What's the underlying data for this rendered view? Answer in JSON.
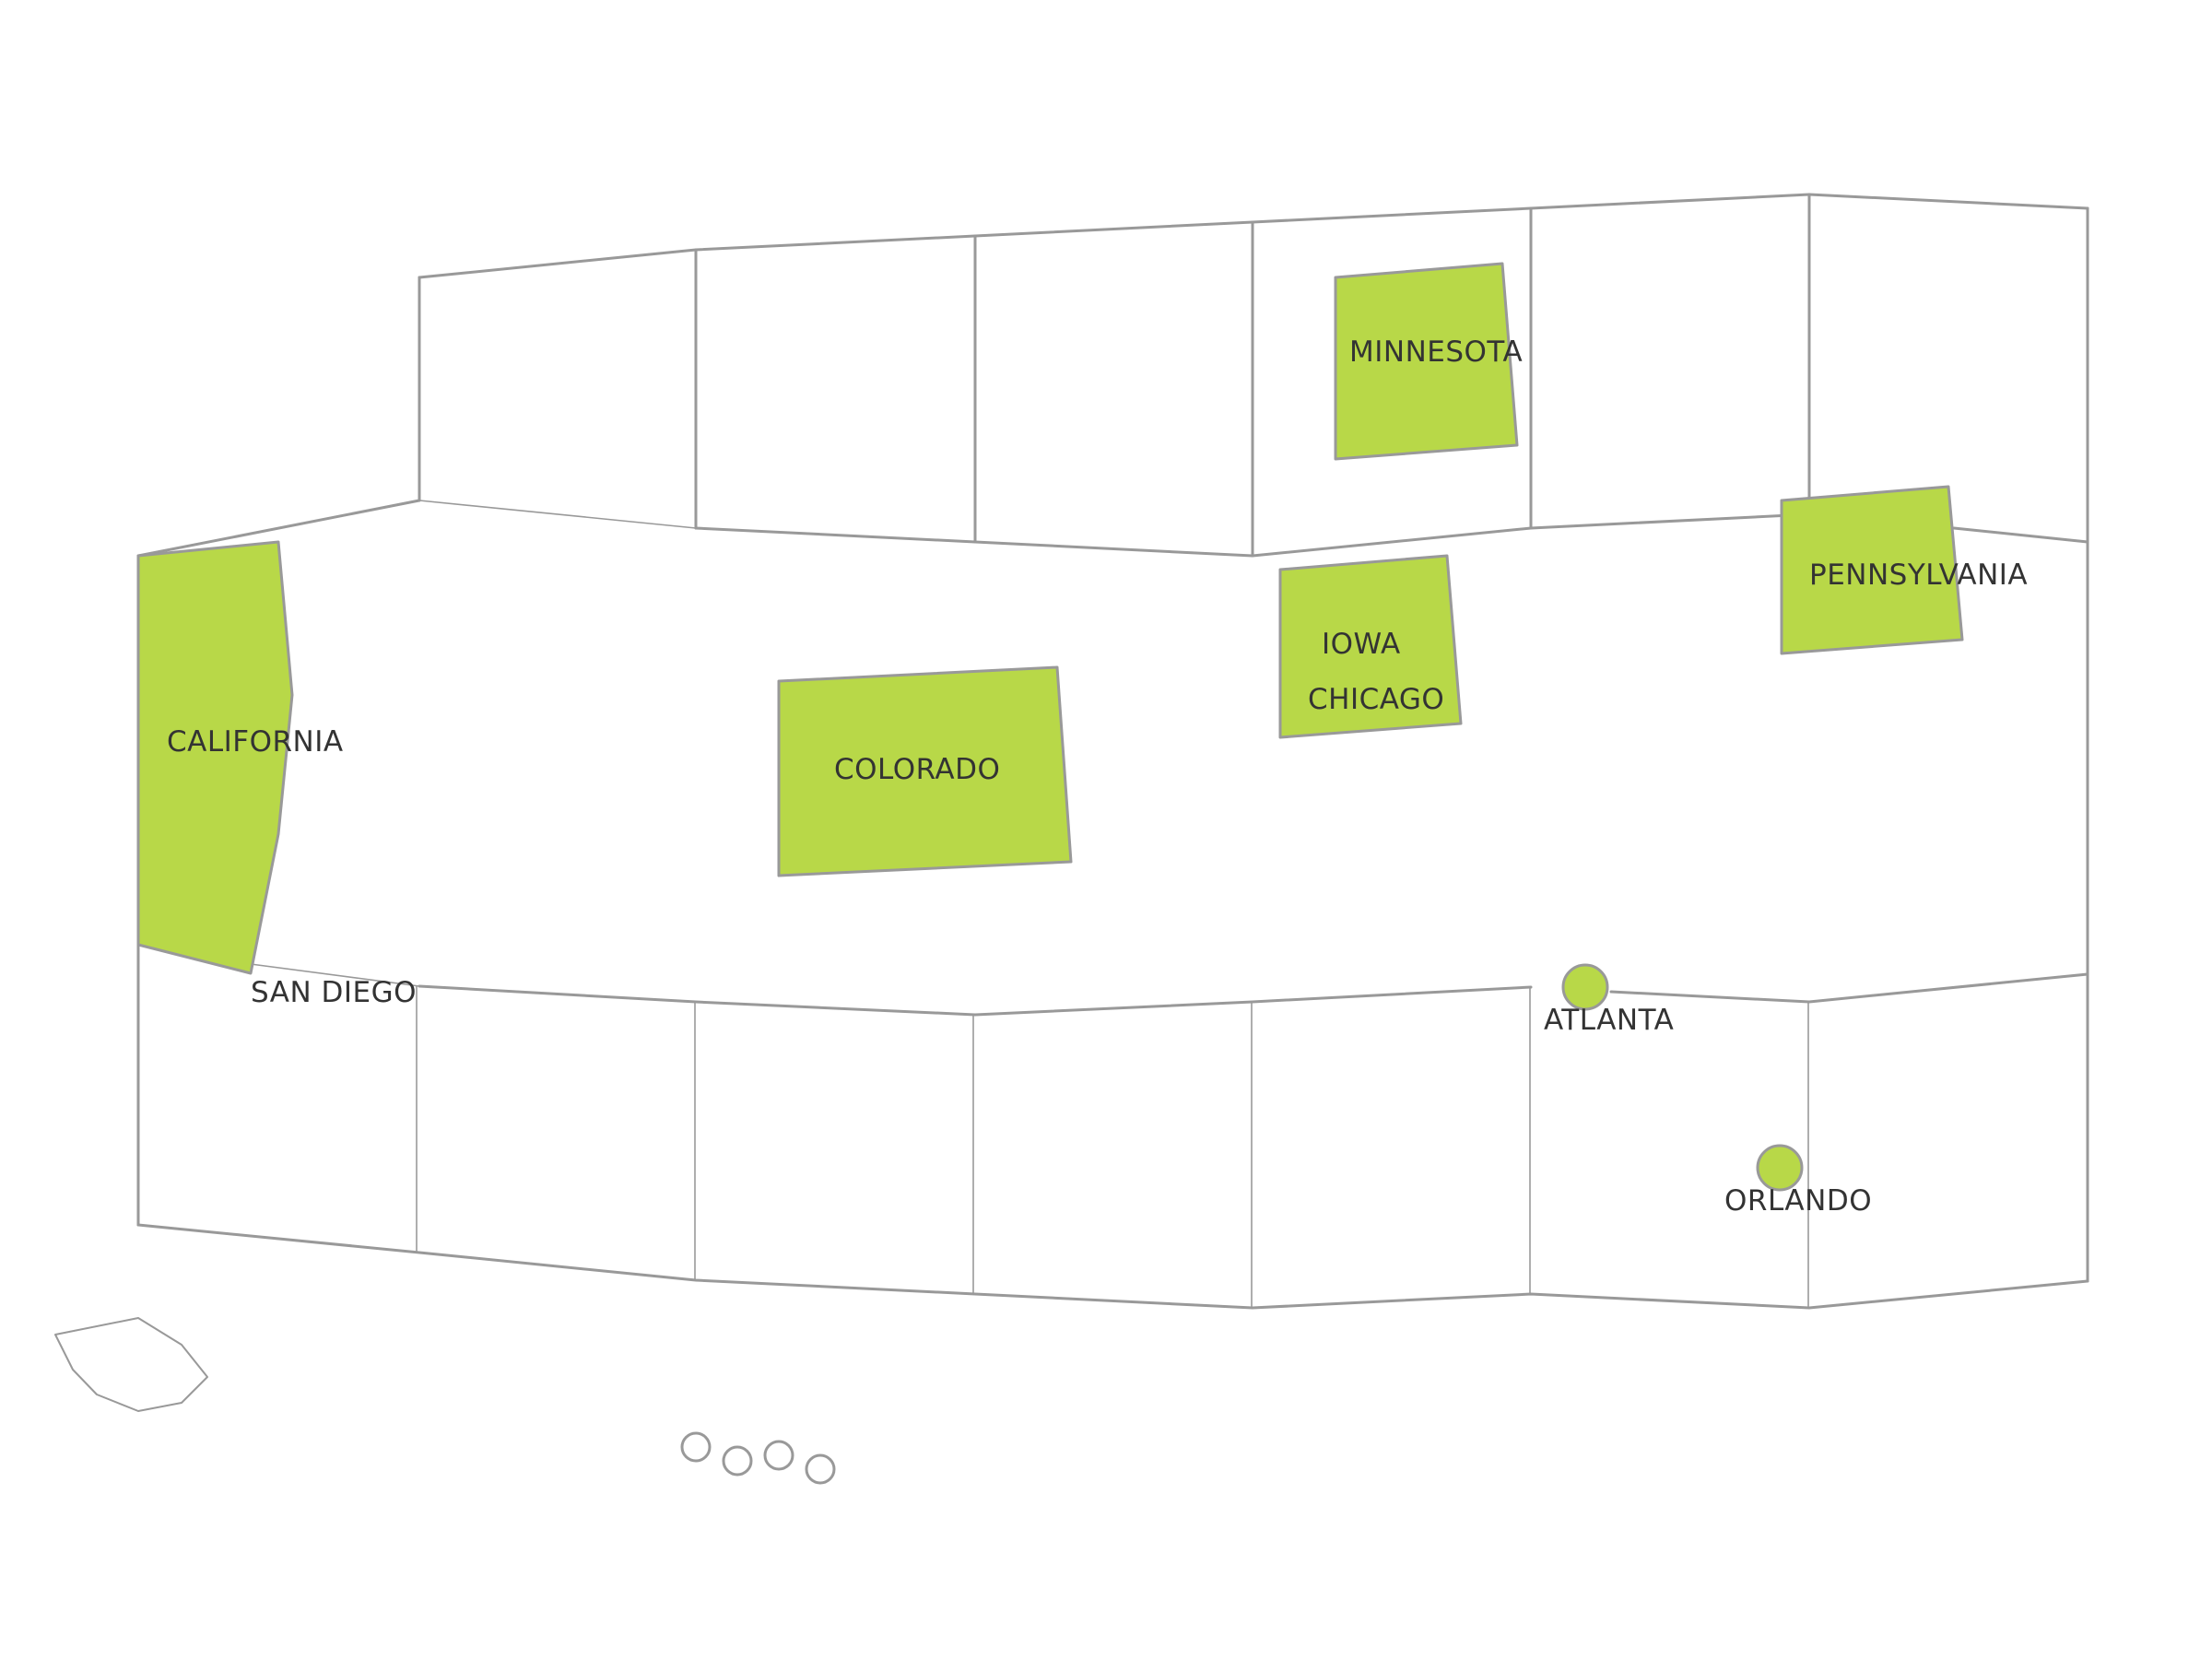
{
  "colors": {
    "background": "#ffffff",
    "border": "#999999",
    "highlight": "#b8d848",
    "label": "#333333"
  },
  "regions": [
    {
      "id": "california",
      "name": "CALIFORNIA"
    },
    {
      "id": "colorado",
      "name": "COLORADO"
    },
    {
      "id": "minnesota",
      "name": "MINNESOTA"
    },
    {
      "id": "iowa",
      "name": "IOWA"
    },
    {
      "id": "pennsylvania",
      "name": "PENNSYLVANIA"
    }
  ],
  "cities": [
    {
      "id": "san-diego",
      "name": "SAN DIEGO"
    },
    {
      "id": "chicago",
      "name": "CHICAGO"
    },
    {
      "id": "atlanta",
      "name": "ATLANTA"
    },
    {
      "id": "orlando",
      "name": "ORLANDO"
    }
  ]
}
